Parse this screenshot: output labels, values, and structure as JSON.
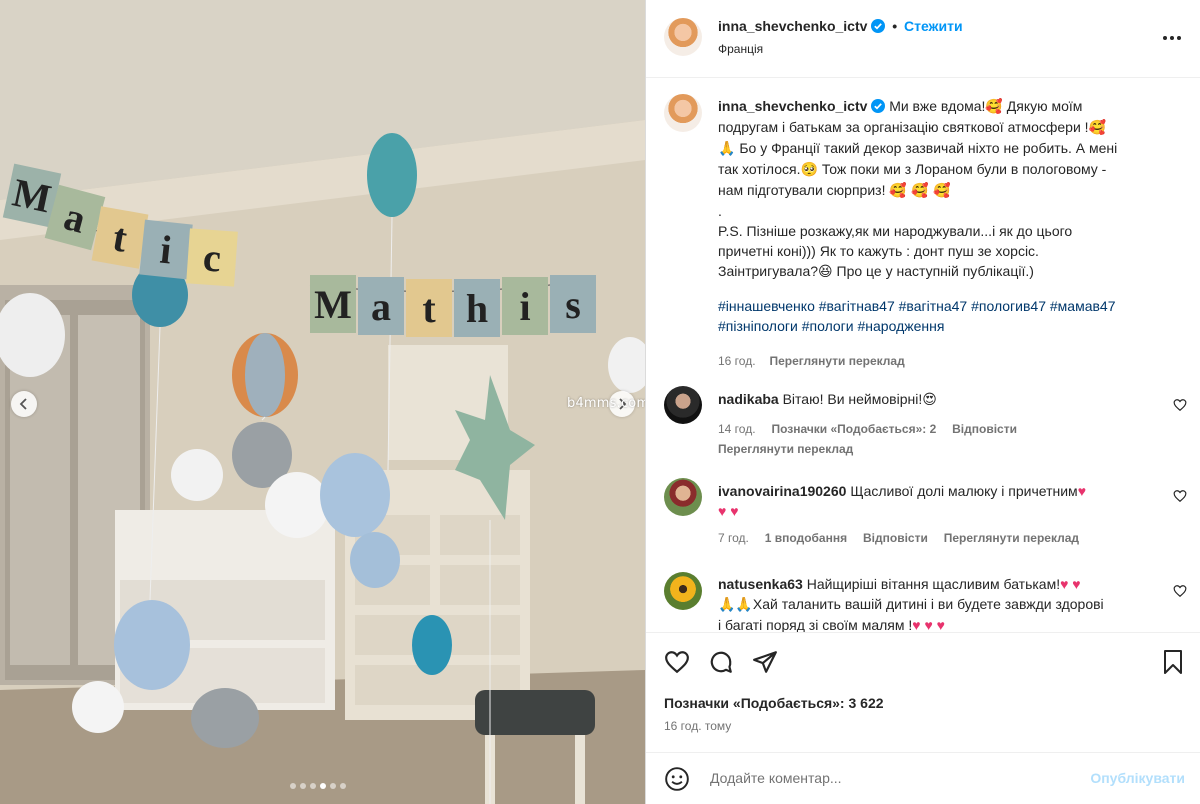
{
  "colors": {
    "accent": "#0095f6",
    "hashtag": "#00376b",
    "meta": "#737373",
    "heart": "#e8336d"
  },
  "media": {
    "watermark": "b4mms.com",
    "carousel_dots": 6,
    "active_dot": 3
  },
  "header": {
    "username": "inna_shevchenko_ictv",
    "separator": "•",
    "follow_label": "Стежити",
    "location": "Франція",
    "more_icon": "more-horizontal-icon"
  },
  "caption": {
    "username": "inna_shevchenko_ictv",
    "lines": [
      "Ми вже вдома!",
      "Дякую моїм",
      "подругам і батькам за організацію святкової атмосфери !",
      "Бо у Франції такий декор зазвичай ніхто не робить. А мені",
      "так хотілося.",
      "Тож поки ми з Лораном були в пологовому -",
      "нам підготували сюрприз!"
    ],
    "dot": ".",
    "ps_lines": [
      "P.S. Пізніше розкажу,як ми народжували...і як до цього",
      "причетні коні))) Як то кажуть : донт пуш зе хорсіс.",
      "Заінтригувала?",
      "Про це у наступній публікації.)"
    ],
    "hashtags_line1": "#іннашевченко #вагітнав47 #вагітна47 #пологив47 #мамав47",
    "hashtags_line2": "#пізніпологи #пологи #народження",
    "time": "16 год.",
    "translate": "Переглянути переклад"
  },
  "comments": [
    {
      "username": "nadikaba",
      "text": "Вітаю! Ви неймовірні!",
      "time": "14 год.",
      "likes": "Позначки «Подобається»: 2",
      "reply": "Відповісти",
      "translate": "Переглянути переклад"
    },
    {
      "username": "ivanovairina190260",
      "text": "Щасливої долі малюку і причетним",
      "time": "7 год.",
      "likes": "1 вподобання",
      "reply": "Відповісти",
      "translate": "Переглянути переклад"
    },
    {
      "username": "natusenka63",
      "text1": "Найщиріші вітання щасливим батькам!",
      "text2": "Хай таланить вашій дитині і ви будете завжди здорові",
      "text3": "і багаті поряд зі своїм малям !"
    }
  ],
  "actions": {
    "likes_label": "Позначки «Подобається»: 3 622",
    "time_ago": "16 год. тому",
    "comment_placeholder": "Додайте коментар...",
    "publish_label": "Опублікувати"
  },
  "banner": {
    "letters_1": [
      "M",
      "a",
      "t",
      "i",
      "c"
    ],
    "letters_2": [
      "M",
      "a",
      "t",
      "h",
      "i",
      "s"
    ]
  }
}
